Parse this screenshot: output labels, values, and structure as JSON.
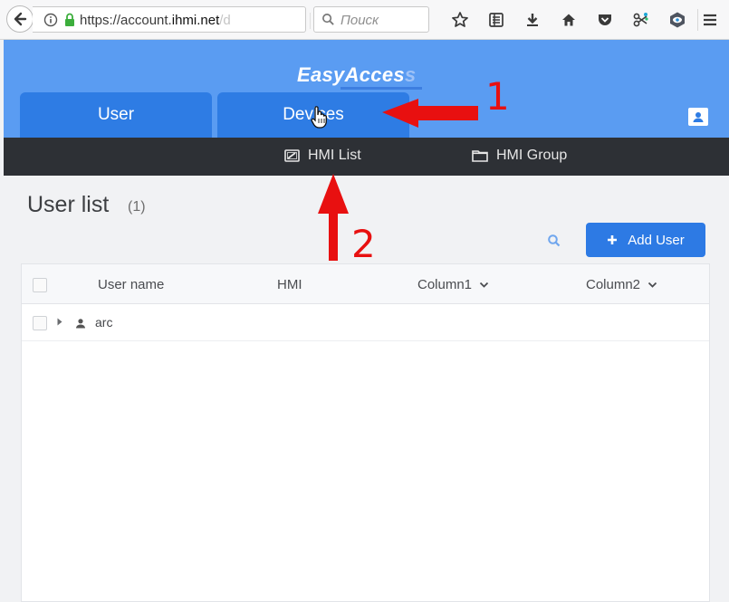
{
  "browser": {
    "url_main": "https://account.",
    "url_domain": "ihmi.net",
    "url_rest": "/d",
    "search_placeholder": "Поиск"
  },
  "app": {
    "logo_main": "EasyAcces",
    "logo_fade": "s",
    "tabs": [
      {
        "label": "User"
      },
      {
        "label": "Devices"
      }
    ],
    "subnav": [
      {
        "label": "HMI List"
      },
      {
        "label": "HMI Group"
      }
    ]
  },
  "content": {
    "title": "User list",
    "count": "(1)",
    "add_button": "Add User",
    "columns": [
      "User name",
      "HMI",
      "Column1",
      "Column2"
    ],
    "rows": [
      {
        "user_name": "arc"
      }
    ]
  },
  "annotations": {
    "label_1": "1",
    "label_2": "2"
  },
  "colors": {
    "header_blue": "#5a9cf2",
    "tab_blue": "#2e7ce4",
    "subnav_dark": "#2d3035",
    "button_blue": "#2d7ae4",
    "annotation_red": "#e81010"
  }
}
